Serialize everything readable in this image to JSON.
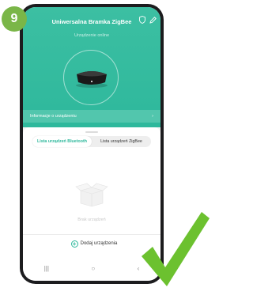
{
  "step": {
    "number": "9"
  },
  "header": {
    "title": "Uniwersalna Bramka ZigBee",
    "status": "Urządzenie online",
    "shield_icon": "shield-icon",
    "edit_icon": "edit-icon"
  },
  "info_bar": {
    "label": "Informacje o urządzeniu",
    "chevron": "›"
  },
  "tabs": [
    {
      "label": "Lista urządzeń Bluetooth",
      "active": true
    },
    {
      "label": "Lista urządzeń ZigBee",
      "active": false
    }
  ],
  "empty_state": {
    "text": "Brak urządzeń"
  },
  "add_button": {
    "label": "Dodaj urządzenia",
    "icon": "+"
  },
  "navbar": {
    "recent": "|||",
    "home": "○",
    "back": "‹"
  },
  "colors": {
    "accent": "#2eb89c",
    "badge": "#7ab648",
    "check": "#6cc12f"
  }
}
